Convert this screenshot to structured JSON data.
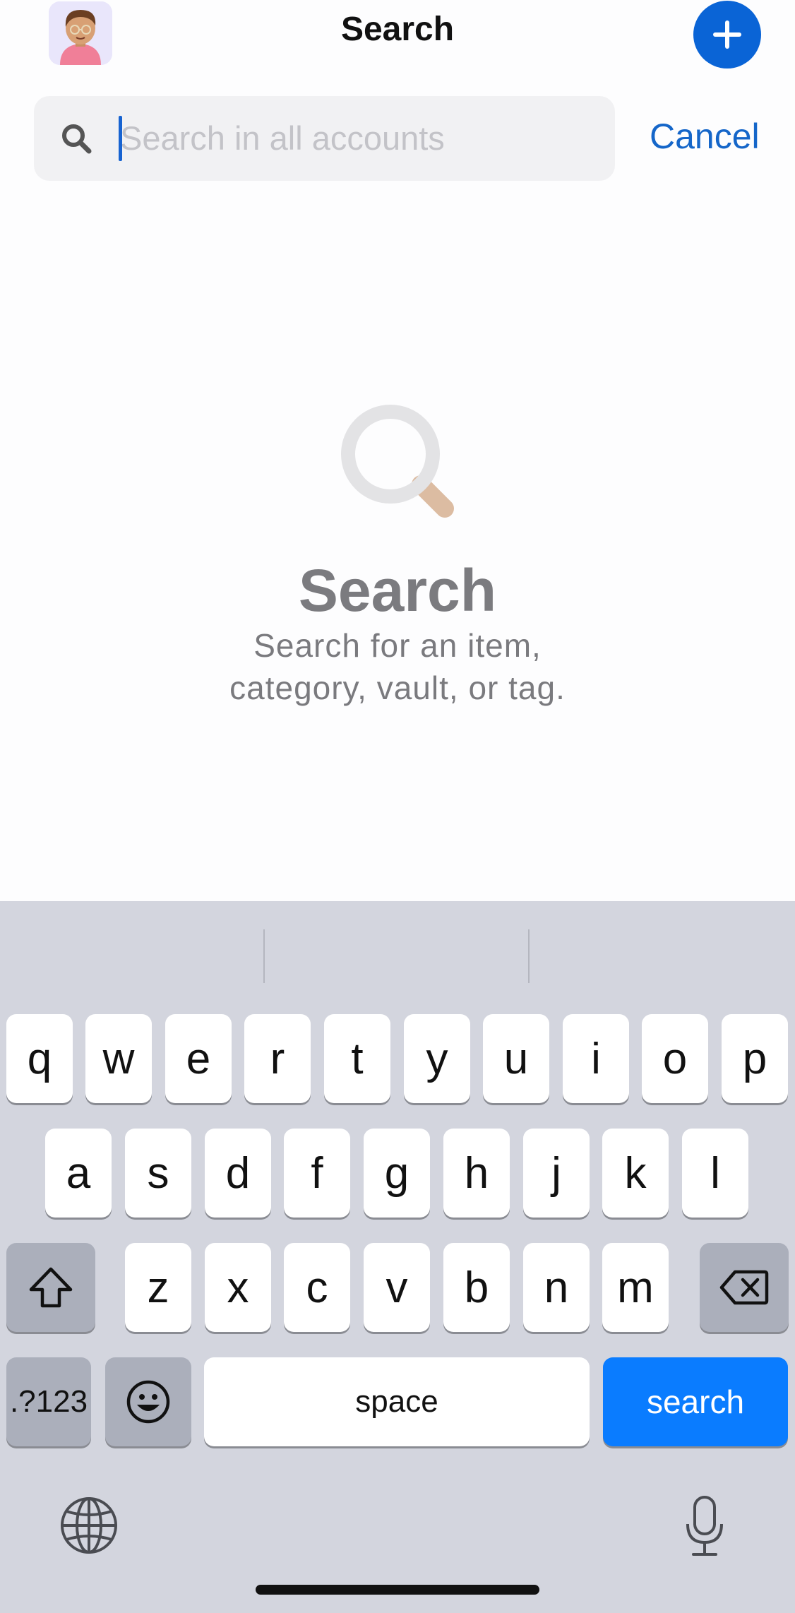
{
  "header": {
    "title": "Search"
  },
  "search": {
    "placeholder": "Search in all accounts",
    "cancel_label": "Cancel"
  },
  "empty_state": {
    "title": "Search",
    "subtitle": "Search for an item,\ncategory, vault, or tag."
  },
  "keyboard": {
    "row1": [
      "q",
      "w",
      "e",
      "r",
      "t",
      "y",
      "u",
      "i",
      "o",
      "p"
    ],
    "row2": [
      "a",
      "s",
      "d",
      "f",
      "g",
      "h",
      "j",
      "k",
      "l"
    ],
    "row3": [
      "z",
      "x",
      "c",
      "v",
      "b",
      "n",
      "m"
    ],
    "numbers_label": ".?123",
    "space_label": "space",
    "search_label": "search"
  },
  "colors": {
    "accent": "#0a64d6",
    "link": "#1566c9",
    "keyboard_background": "#d3d5de",
    "search_key": "#0a7cff"
  },
  "icons": {
    "avatar": "user-avatar",
    "add": "plus-icon",
    "search_field": "search-icon",
    "empty_state": "magnifier-illustration",
    "shift": "shift-icon",
    "delete": "delete-icon",
    "emoji": "emoji-icon",
    "globe": "globe-icon",
    "mic": "microphone-icon"
  }
}
